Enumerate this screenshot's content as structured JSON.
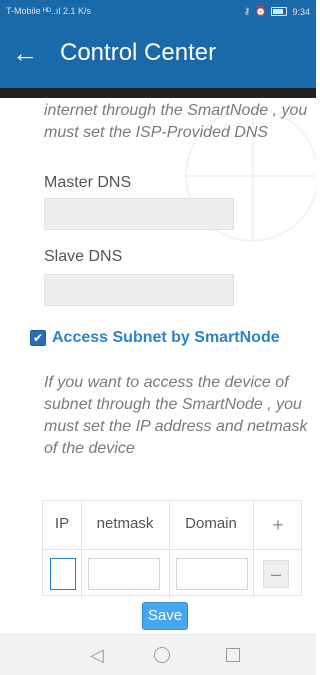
{
  "status_bar": {
    "carrier": "T-Mobile",
    "signal": "ᴴᴰ..ıl",
    "speed": "2.1 K/s",
    "time": "9:34",
    "icons": [
      "key-icon",
      "alarm-icon",
      "battery-icon"
    ]
  },
  "app_bar": {
    "title": "Control Center",
    "back_icon": "arrow-left-icon"
  },
  "dns": {
    "hint_text": "internet through the SmartNode , you must set the ISP-Provided DNS",
    "master_label": "Master DNS",
    "master_value": "",
    "slave_label": "Slave DNS",
    "slave_value": ""
  },
  "subnet": {
    "checkbox_checked": true,
    "title": "Access Subnet by SmartNode",
    "hint_text": "If you want to access the device of subnet through the SmartNode , you must set the IP address and netmask of the device",
    "table": {
      "headers": [
        "IP",
        "netmask",
        "Domain",
        "+"
      ],
      "rows": [
        {
          "ip": "",
          "netmask": "",
          "domain": "",
          "action": "–"
        }
      ]
    },
    "save_label": "Save"
  },
  "nav": {
    "back": "◁",
    "home": "○",
    "recent": "□"
  },
  "colors": {
    "primary": "#1a6aa9",
    "accent": "#2a84c6",
    "save_button": "#45a5ef"
  }
}
